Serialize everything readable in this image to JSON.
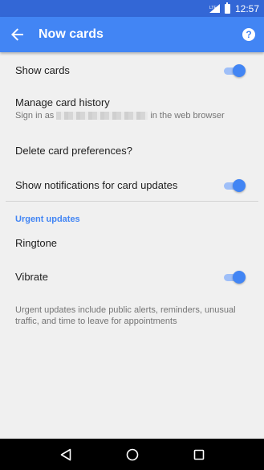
{
  "status_bar": {
    "time": "12:57",
    "signal_label": "LTE"
  },
  "app_bar": {
    "title": "Now cards",
    "help_glyph": "?"
  },
  "settings": {
    "show_cards": {
      "label": "Show cards",
      "enabled": true
    },
    "manage_history": {
      "label": "Manage card history",
      "sub_prefix": "Sign in as",
      "sub_suffix": "in the web browser"
    },
    "delete_prefs": {
      "label": "Delete card preferences?"
    },
    "notifications": {
      "label": "Show notifications for card updates",
      "enabled": true
    },
    "urgent_header": "Urgent updates",
    "ringtone": {
      "label": "Ringtone"
    },
    "vibrate": {
      "label": "Vibrate",
      "enabled": true
    },
    "footnote": "Urgent updates include public alerts, reminders, unusual traffic, and time to leave for appointments"
  },
  "colors": {
    "accent": "#4285f4",
    "status_bar": "#3367d6",
    "background": "#f0f0f0"
  }
}
